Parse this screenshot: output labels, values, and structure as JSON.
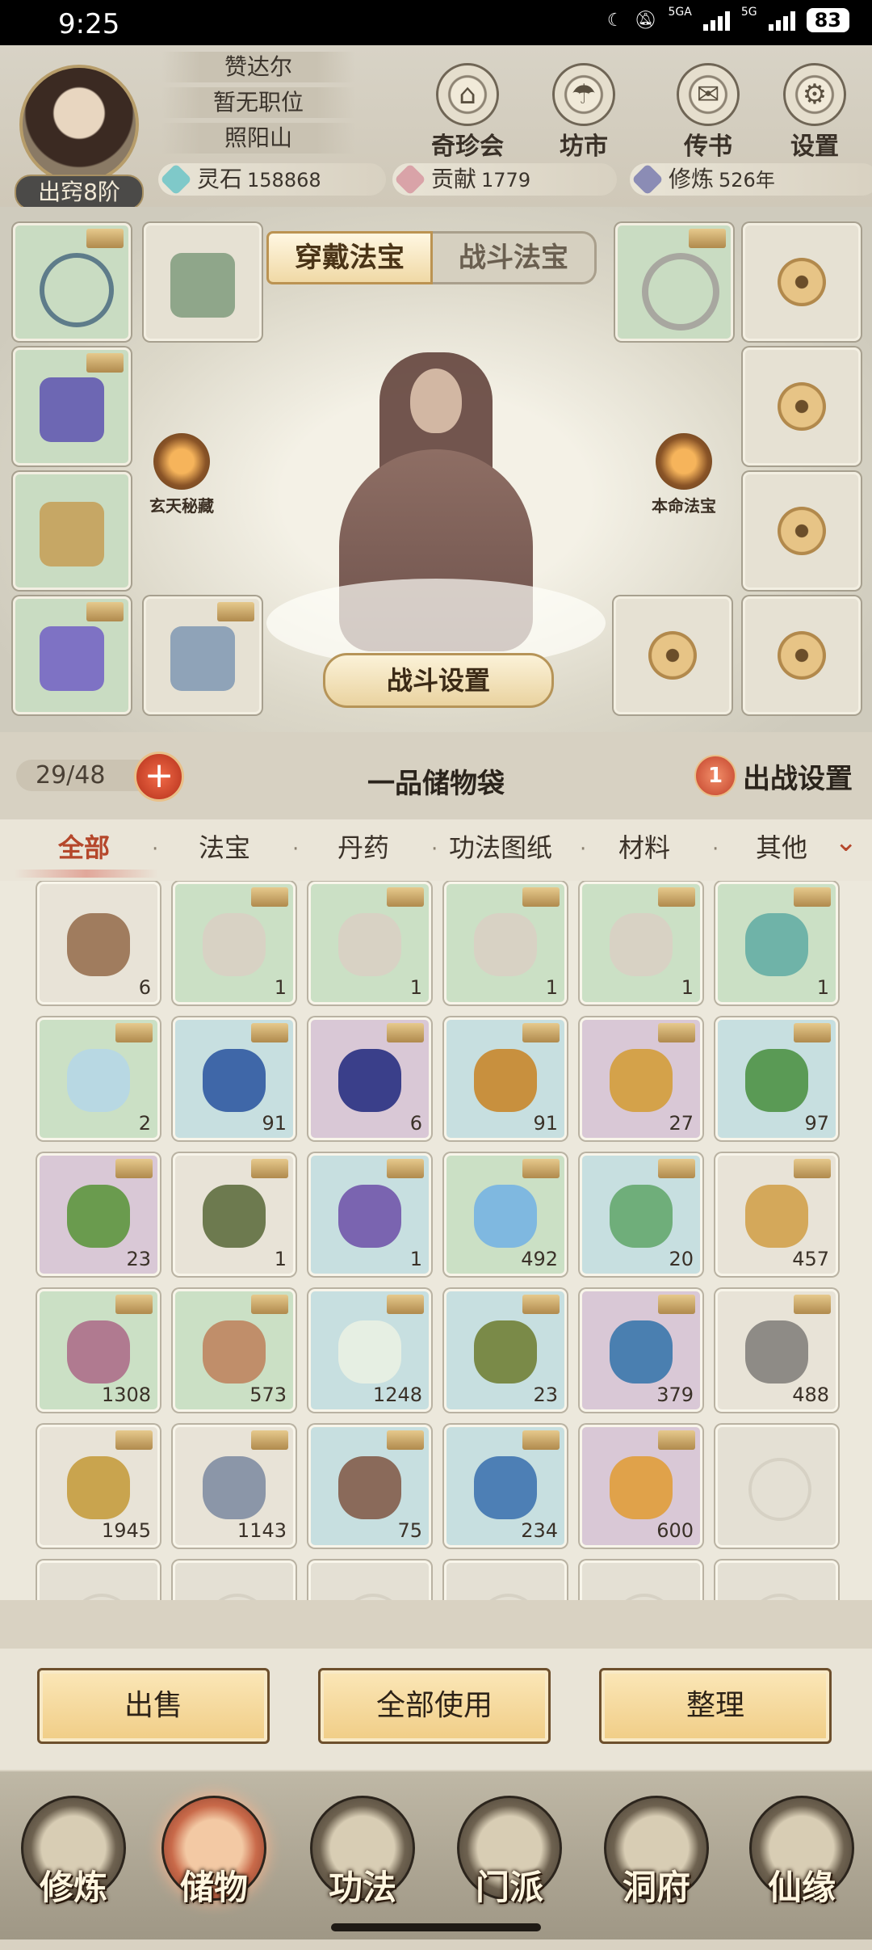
{
  "status_bar": {
    "time": "9:25",
    "network_1": "5GA",
    "network_2": "5G",
    "battery": "83"
  },
  "header": {
    "player_name": "赞达尔",
    "position": "暂无职位",
    "location": "照阳山",
    "realm": "出窍8阶",
    "buttons": [
      {
        "label": "奇珍会",
        "icon": "treasure-pavilion-icon"
      },
      {
        "label": "坊市",
        "icon": "market-icon"
      },
      {
        "label": "传书",
        "icon": "scroll-letter-icon"
      },
      {
        "label": "设置",
        "icon": "gear-icon"
      }
    ],
    "resources": [
      {
        "label": "灵石",
        "value": "158868",
        "color": "#7fc9c9"
      },
      {
        "label": "贡献",
        "value": "1779",
        "color": "#d9a3a8"
      },
      {
        "label": "修炼",
        "value": "526年",
        "color": "#8b8cb5"
      }
    ]
  },
  "equipment": {
    "tabs": [
      "穿戴法宝",
      "战斗法宝"
    ],
    "active_tab": "穿戴法宝",
    "left_feature": "玄天秘藏",
    "right_feature": "本命法宝",
    "battle_settings": "战斗设置"
  },
  "bag": {
    "capacity": "29/48",
    "title": "一品储物袋",
    "deploy_count": "1",
    "deploy_label": "出战设置"
  },
  "categories": [
    "全部",
    "法宝",
    "丹药",
    "功法图纸",
    "材料",
    "其他"
  ],
  "active_category": "全部",
  "inventory": [
    {
      "name": "spirit-orb",
      "rarity": "white",
      "count": "6",
      "color": "#a07c5e"
    },
    {
      "name": "technique-book",
      "rarity": "green",
      "count": "1",
      "color": "#d8d2c4"
    },
    {
      "name": "technique-book",
      "rarity": "green",
      "count": "1",
      "color": "#d8d2c4"
    },
    {
      "name": "technique-book",
      "rarity": "green",
      "count": "1",
      "color": "#d8d2c4"
    },
    {
      "name": "technique-book",
      "rarity": "green",
      "count": "1",
      "color": "#d8d2c4"
    },
    {
      "name": "jade-vase",
      "rarity": "green",
      "count": "1",
      "color": "#6fb3a8"
    },
    {
      "name": "pill-bottle",
      "rarity": "green",
      "count": "2",
      "color": "#b8d8e3"
    },
    {
      "name": "blue-lotus",
      "rarity": "blue",
      "count": "91",
      "color": "#3f67a8"
    },
    {
      "name": "purple-lotus",
      "rarity": "purple",
      "count": "6",
      "color": "#3a3f8a"
    },
    {
      "name": "golden-grass",
      "rarity": "blue",
      "count": "91",
      "color": "#c8903e"
    },
    {
      "name": "glowing-grass",
      "rarity": "purple",
      "count": "27",
      "color": "#d4a24a"
    },
    {
      "name": "spirit-herb",
      "rarity": "blue",
      "count": "97",
      "color": "#5a9a55"
    },
    {
      "name": "fairy-herb",
      "rarity": "purple",
      "count": "23",
      "color": "#6a9b4e"
    },
    {
      "name": "green-boots",
      "rarity": "white",
      "count": "1",
      "color": "#6d7a4f"
    },
    {
      "name": "flying-spear",
      "rarity": "blue",
      "count": "1",
      "color": "#7a64b0"
    },
    {
      "name": "water-drop",
      "rarity": "green",
      "count": "492",
      "color": "#7fb8e0"
    },
    {
      "name": "jade-bead",
      "rarity": "blue",
      "count": "20",
      "color": "#6fae7a"
    },
    {
      "name": "ginseng-root",
      "rarity": "white",
      "count": "457",
      "color": "#d4a85a"
    },
    {
      "name": "pink-herb",
      "rarity": "green",
      "count": "1308",
      "color": "#b07a90"
    },
    {
      "name": "dried-root",
      "rarity": "green",
      "count": "573",
      "color": "#c08e6a"
    },
    {
      "name": "white-flower",
      "rarity": "blue",
      "count": "1248",
      "color": "#e6efe3"
    },
    {
      "name": "berry-branch",
      "rarity": "blue",
      "count": "23",
      "color": "#7a8a48"
    },
    {
      "name": "spirit-fruit-branch",
      "rarity": "purple",
      "count": "379",
      "color": "#4a7fb0"
    },
    {
      "name": "grey-stone",
      "rarity": "white",
      "count": "488",
      "color": "#8e8b86"
    },
    {
      "name": "gold-ore",
      "rarity": "white",
      "count": "1945",
      "color": "#c9a44e"
    },
    {
      "name": "iron-ore",
      "rarity": "white",
      "count": "1143",
      "color": "#8b96a8"
    },
    {
      "name": "red-rock",
      "rarity": "blue",
      "count": "75",
      "color": "#8a6a5a"
    },
    {
      "name": "blue-crystal",
      "rarity": "blue",
      "count": "234",
      "color": "#4d7fb5"
    },
    {
      "name": "amber-crystal",
      "rarity": "purple",
      "count": "600",
      "color": "#e0a24a"
    }
  ],
  "actions": [
    "出售",
    "全部使用",
    "整理"
  ],
  "bottom_nav": [
    "修炼",
    "储物",
    "功法",
    "门派",
    "洞府",
    "仙缘"
  ],
  "active_nav": "储物"
}
